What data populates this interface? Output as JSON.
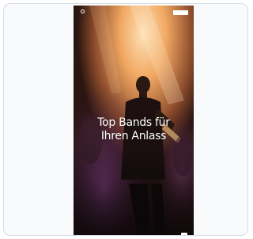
{
  "page": {
    "headline": {
      "line1": "Top Bands für",
      "line2": "Ihren Anlass"
    }
  },
  "colors": {
    "card_border": "#d6dce6",
    "card_bg": "#f8fafc",
    "stage_light": "#f4b574",
    "stage_dark": "#140d0b",
    "purple_haze": "#7d3c8c",
    "headline_text": "#ffffff"
  },
  "icons": {
    "logo": "circle-mark-icon"
  }
}
